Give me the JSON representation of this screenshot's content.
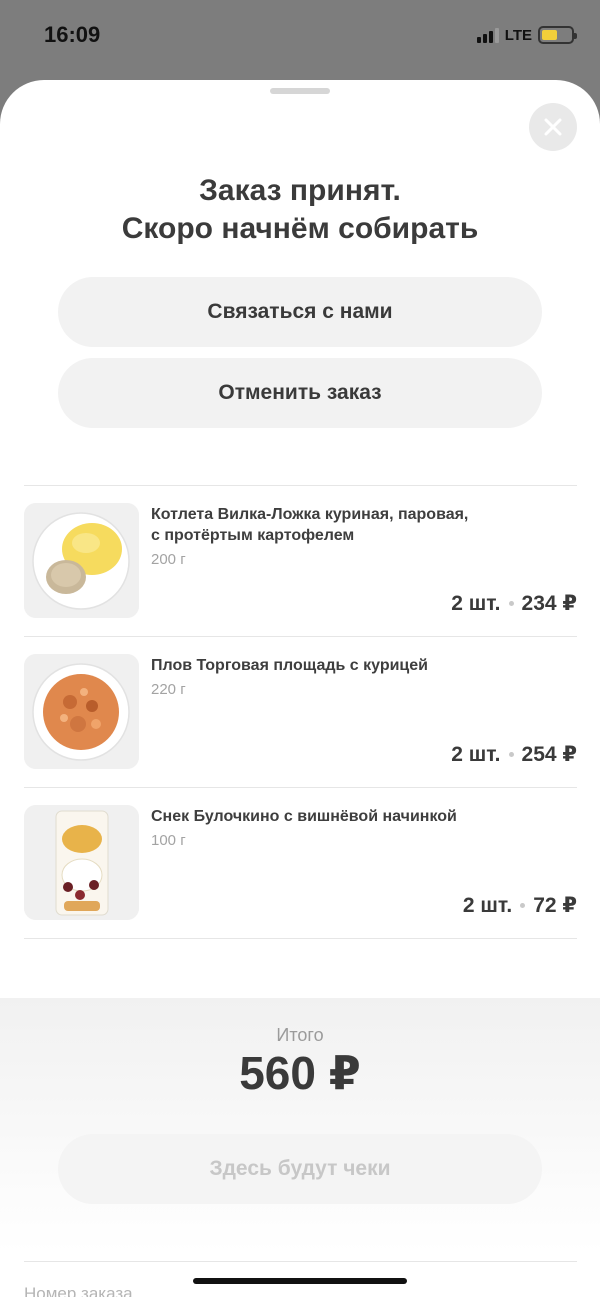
{
  "status_bar": {
    "time": "16:09",
    "network": "LTE",
    "battery_level": 0.55,
    "icons": [
      "signal-icon",
      "battery-icon"
    ]
  },
  "sheet": {
    "title_line1": "Заказ принят.",
    "title_line2": "Скоро начнём собирать",
    "close_icon": "close-icon",
    "contact_button": "Связаться с нами",
    "cancel_button": "Отменить заказ"
  },
  "items": [
    {
      "name_line1": "Котлета Вилка-Ложка куриная, паровая,",
      "name_line2": "с протёртым картофелем",
      "weight": "200 г",
      "quantity": "2 шт.",
      "price": "234 ₽"
    },
    {
      "name_line1": "Плов Торговая площадь с курицей",
      "name_line2": "",
      "weight": "220 г",
      "quantity": "2 шт.",
      "price": "254 ₽"
    },
    {
      "name_line1": "Снек Булочкино с вишнёвой начинкой",
      "name_line2": "",
      "weight": "100 г",
      "quantity": "2 шт.",
      "price": "72 ₽"
    }
  ],
  "total": {
    "label": "Итого",
    "value": "560 ₽"
  },
  "receipts_button": "Здесь будут чеки",
  "order_number_label": "Номер заказа",
  "colors": {
    "sheet_bg": "#ffffff",
    "button_bg": "#f2f2f2",
    "text_primary": "#3a3a3a",
    "text_muted": "#a3a3a3",
    "battery": "#f2cf3a"
  }
}
